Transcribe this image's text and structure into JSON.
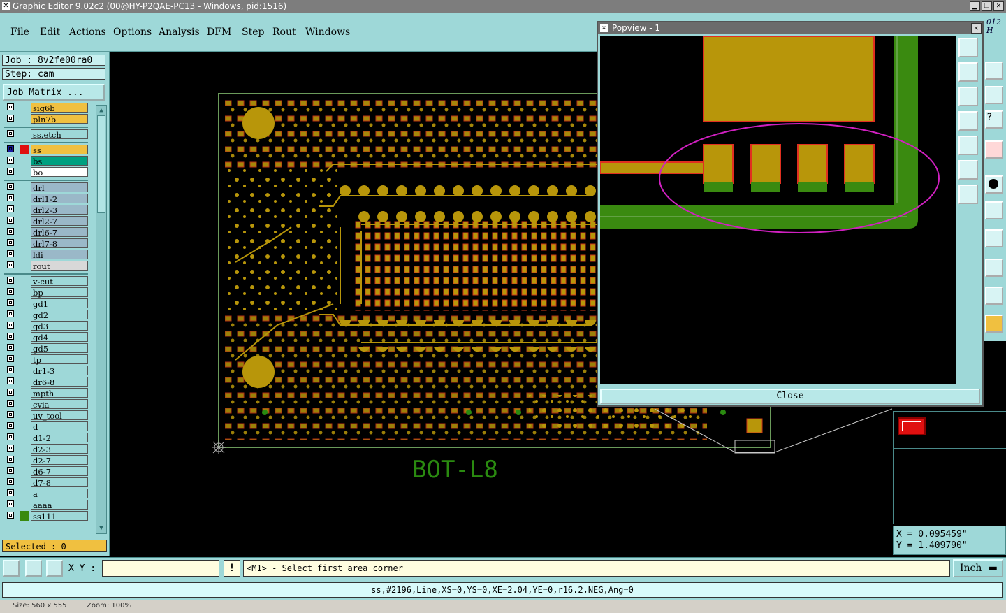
{
  "window": {
    "title": "Graphic Editor 9.02c2 (00@HY-P2QAE-PC13 - Windows, pid:1516)"
  },
  "menu": [
    "File",
    "Edit",
    "Actions",
    "Options",
    "Analysis",
    "DFM",
    "Step",
    "Rout",
    "Windows"
  ],
  "job": {
    "job_line": "Job : 8v2fe00ra0",
    "step_line": "Step: cam",
    "matrix_button": "Job Matrix ..."
  },
  "layers": [
    {
      "name": "sig6b",
      "color": "#f0c040"
    },
    {
      "name": "pln7b",
      "color": "#f0c040"
    },
    {
      "name": "ss.etch",
      "color": "#9ed8d8"
    },
    {
      "name": "ss",
      "color": "#f0c040",
      "active": true
    },
    {
      "name": "bs",
      "color": "#00a080"
    },
    {
      "name": "bo",
      "color": "#ffffff"
    },
    {
      "name": "drl",
      "color": "#9ab8c8"
    },
    {
      "name": "drl1-2",
      "color": "#9ab8c8"
    },
    {
      "name": "drl2-3",
      "color": "#9ab8c8"
    },
    {
      "name": "drl2-7",
      "color": "#9ab8c8"
    },
    {
      "name": "drl6-7",
      "color": "#9ab8c8"
    },
    {
      "name": "drl7-8",
      "color": "#9ab8c8"
    },
    {
      "name": "ldi",
      "color": "#9ab8c8"
    },
    {
      "name": "rout",
      "color": "#d8d8d8"
    },
    {
      "name": "v-cut",
      "color": "#9ed8d8"
    },
    {
      "name": "bp",
      "color": "#9ed8d8"
    },
    {
      "name": "gd1",
      "color": "#9ed8d8"
    },
    {
      "name": "gd2",
      "color": "#9ed8d8"
    },
    {
      "name": "gd3",
      "color": "#9ed8d8"
    },
    {
      "name": "gd4",
      "color": "#9ed8d8"
    },
    {
      "name": "gd5",
      "color": "#9ed8d8"
    },
    {
      "name": "tp",
      "color": "#9ed8d8"
    },
    {
      "name": "dr1-3",
      "color": "#9ed8d8"
    },
    {
      "name": "dr6-8",
      "color": "#9ed8d8"
    },
    {
      "name": "mpth",
      "color": "#9ed8d8"
    },
    {
      "name": "cvia",
      "color": "#9ed8d8"
    },
    {
      "name": "uv_tool",
      "color": "#9ed8d8"
    },
    {
      "name": "d",
      "color": "#9ed8d8"
    },
    {
      "name": "d1-2",
      "color": "#9ed8d8"
    },
    {
      "name": "d2-3",
      "color": "#9ed8d8"
    },
    {
      "name": "d2-7",
      "color": "#9ed8d8"
    },
    {
      "name": "d6-7",
      "color": "#9ed8d8"
    },
    {
      "name": "d7-8",
      "color": "#9ed8d8"
    },
    {
      "name": "a",
      "color": "#9ed8d8"
    },
    {
      "name": "aaaa",
      "color": "#9ed8d8"
    },
    {
      "name": "ss111",
      "color": "#9ed8d8"
    }
  ],
  "selected": "Selected : 0",
  "canvas": {
    "board_label": "BOT-L8"
  },
  "popview": {
    "title": "Popview - 1",
    "close_label": "Close"
  },
  "coords": {
    "x": "X = 0.095459\"",
    "y": "Y = 1.409790\""
  },
  "cmd": {
    "xy_label": "X Y :",
    "info_icon": "!",
    "prompt": "<M1> - Select first area corner",
    "units": "Inch"
  },
  "status": "ss,#2196,Line,XS=0,YS=0,XE=2.04,YE=0,r16.2,NEG,Ang=0",
  "bottom": {
    "size_text": "Size: 560 x 555",
    "zoom_text": "Zoom: 100%"
  },
  "corner_text": "012\nH",
  "colors": {
    "panel": "#9ed8d8",
    "copper": "#b8960a",
    "pad_outline": "#e03020",
    "board_green": "#3a8a10"
  }
}
